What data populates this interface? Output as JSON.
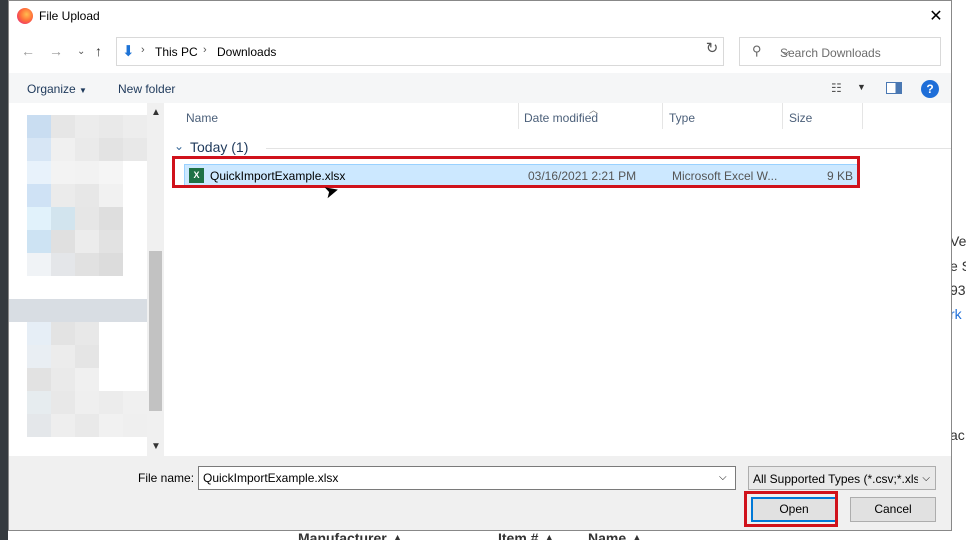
{
  "window": {
    "title": "File Upload",
    "close_label": "✕"
  },
  "nav": {
    "breadcrumb": [
      "This PC",
      "Downloads"
    ],
    "search_placeholder": "Search Downloads"
  },
  "toolbar": {
    "organize_label": "Organize",
    "new_folder_label": "New folder",
    "help_label": "?"
  },
  "columns": {
    "name": "Name",
    "date_modified": "Date modified",
    "type": "Type",
    "size": "Size"
  },
  "group": {
    "label": "Today (1)"
  },
  "files": [
    {
      "name": "QuickImportExample.xlsx",
      "date_modified": "03/16/2021 2:21 PM",
      "type": "Microsoft Excel W...",
      "size": "9 KB",
      "icon": "excel-file-icon",
      "selected": true
    }
  ],
  "bottom": {
    "file_name_label": "File name:",
    "file_name_value": "QuickImportExample.xlsx",
    "filter_value": "All Supported Types (*.csv;*.xls;",
    "open_label": "Open",
    "cancel_label": "Cancel"
  },
  "background": {
    "right_fragments": [
      "Ve",
      "e S",
      "93",
      "rk",
      "ac"
    ],
    "bottom_fragments": [
      "Manufacturer ▲",
      "Item # ▲",
      "Name ▲"
    ]
  },
  "colors": {
    "highlight": "#d0121b",
    "selection": "#cce8ff",
    "accent": "#0078d7"
  }
}
